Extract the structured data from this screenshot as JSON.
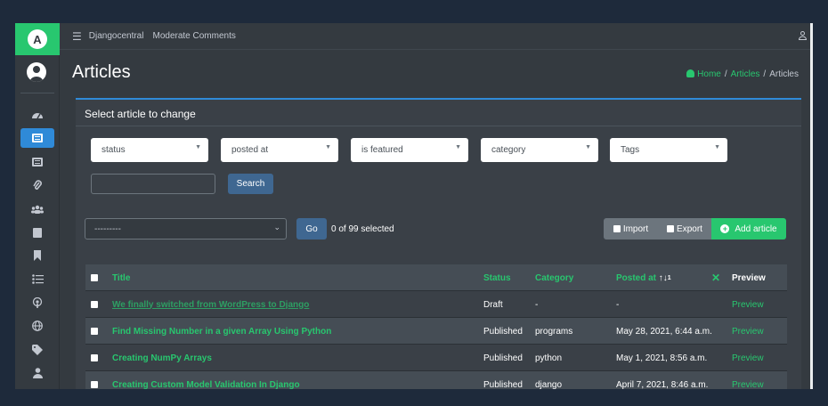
{
  "topbar": {
    "links": [
      "Djangocentral",
      "Moderate Comments"
    ]
  },
  "header": {
    "title": "Articles",
    "breadcrumb": [
      "Home",
      "Articles",
      "Articles"
    ],
    "separator": "/"
  },
  "card": {
    "title": "Select article to change",
    "filters": [
      "status",
      "posted at",
      "is featured",
      "category",
      "Tags"
    ],
    "search_value": "",
    "search_label": "Search",
    "action_value": "---------",
    "go_label": "Go",
    "selected_text": "0 of 99 selected",
    "import_label": "Import",
    "export_label": "Export",
    "add_label": "Add article"
  },
  "table": {
    "headers": {
      "title": "Title",
      "status": "Status",
      "category": "Category",
      "posted": "Posted at",
      "sort_indicator": "1",
      "clear": "✕",
      "preview": "Preview"
    },
    "rows": [
      {
        "title": "We finally switched from WordPress to Django",
        "status": "Draft",
        "category": "-",
        "posted": "-",
        "preview": "Preview"
      },
      {
        "title": "Find Missing Number in a given Array Using Python",
        "status": "Published",
        "category": "programs",
        "posted": "May 28, 2021, 6:44 a.m.",
        "preview": "Preview"
      },
      {
        "title": "Creating NumPy Arrays",
        "status": "Published",
        "category": "python",
        "posted": "May 1, 2021, 8:56 a.m.",
        "preview": "Preview"
      },
      {
        "title": "Creating Custom Model Validation In Django",
        "status": "Published",
        "category": "django",
        "posted": "April 7, 2021, 8:46 a.m.",
        "preview": "Preview"
      }
    ]
  },
  "colors": {
    "accent": "#28c76f",
    "primary": "#2f8ad8",
    "button": "#3f6791",
    "background": "#343a40"
  }
}
